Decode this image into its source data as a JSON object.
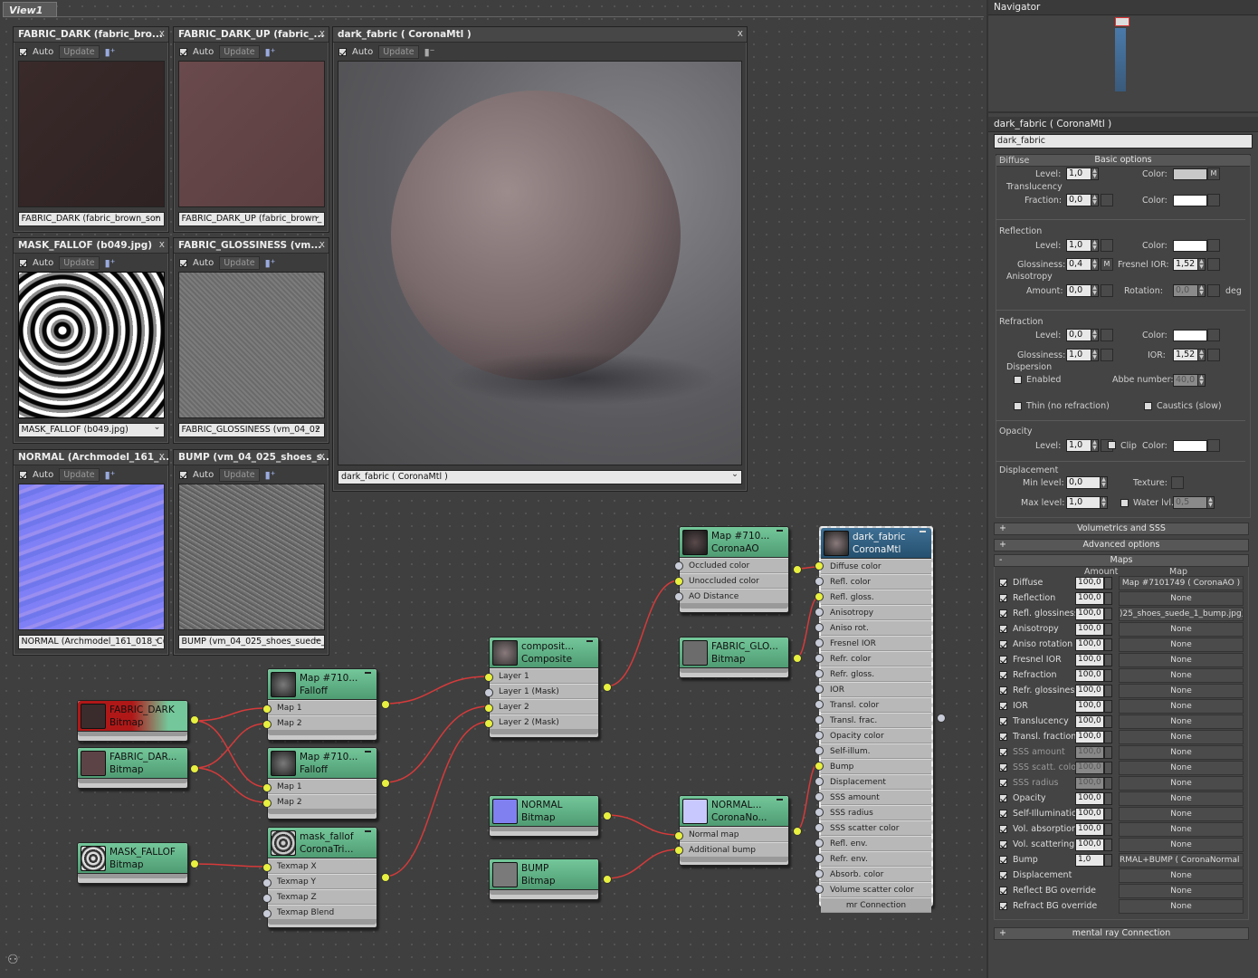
{
  "view": {
    "tab": "View1"
  },
  "previews": {
    "fabric_dark": {
      "title": "FABRIC_DARK (fabric_bro...",
      "dropdown": "FABRIC_DARK (fabric_brown_son"
    },
    "fabric_dark_up": {
      "title": "FABRIC_DARK_UP (fabric_...",
      "dropdown": "FABRIC_DARK_UP (fabric_brown_"
    },
    "dark_fabric": {
      "title": "dark_fabric  ( CoronaMtl )",
      "dropdown": "dark_fabric  ( CoronaMtl )"
    },
    "mask_falloff": {
      "title": "MASK_FALLOF (b049.jpg)",
      "dropdown": "MASK_FALLOF (b049.jpg)"
    },
    "fabric_glossiness": {
      "title": "FABRIC_GLOSSINESS (vm...",
      "dropdown": "FABRIC_GLOSSINESS (vm_04_02"
    },
    "normal": {
      "title": "NORMAL (Archmodel_161_...",
      "dropdown": "NORMAL (Archmodel_161_018_C("
    },
    "bump": {
      "title": "BUMP (vm_04_025_shoes_s...",
      "dropdown": "BUMP (vm_04_025_shoes_suede_"
    },
    "auto_label": "Auto",
    "update_label": "Update",
    "close": "x"
  },
  "nodes": {
    "fabric_dark": {
      "l1": "FABRIC_DARK",
      "l2": "Bitmap"
    },
    "fabric_dar2": {
      "l1": "FABRIC_DAR...",
      "l2": "Bitmap"
    },
    "mask_fallof": {
      "l1": "MASK_FALLOF",
      "l2": "Bitmap"
    },
    "falloff1": {
      "l1": "Map #710...",
      "l2": "Falloff",
      "rows": [
        "Map 1",
        "Map 2"
      ]
    },
    "falloff2": {
      "l1": "Map #710...",
      "l2": "Falloff",
      "rows": [
        "Map 1",
        "Map 2"
      ]
    },
    "triplanar": {
      "l1": "mask_fallof",
      "l2": "CoronaTri...",
      "rows": [
        "Texmap X",
        "Texmap Y",
        "Texmap Z",
        "Texmap Blend"
      ]
    },
    "composite": {
      "l1": "composit...",
      "l2": "Composite",
      "rows": [
        "Layer 1",
        "Layer 1 (Mask)",
        "Layer 2",
        "Layer 2 (Mask)"
      ]
    },
    "normal_bmp": {
      "l1": "NORMAL",
      "l2": "Bitmap"
    },
    "bump_bmp": {
      "l1": "BUMP",
      "l2": "Bitmap"
    },
    "ao": {
      "l1": "Map #710...",
      "l2": "CoronaAO",
      "rows": [
        "Occluded color",
        "Unoccluded color",
        "AO Distance"
      ]
    },
    "gloss_bmp": {
      "l1": "FABRIC_GLO...",
      "l2": "Bitmap"
    },
    "normalmap": {
      "l1": "NORMAL...",
      "l2": "CoronaNo...",
      "rows": [
        "Normal map",
        "Additional bump"
      ]
    },
    "mtl": {
      "l1": "dark_fabric",
      "l2": "CoronaMtl",
      "rows": [
        "Diffuse color",
        "Refl. color",
        "Refl. gloss.",
        "Anisotropy",
        "Aniso rot.",
        "Fresnel IOR",
        "Refr. color",
        "Refr. gloss.",
        "IOR",
        "Transl. color",
        "Transl. frac.",
        "Opacity color",
        "Self-illum.",
        "Bump",
        "Displacement",
        "SSS amount",
        "SSS radius",
        "SSS scatter color",
        "Refl. env.",
        "Refr. env.",
        "Absorb. color",
        "Volume scatter color"
      ],
      "footer": "mr Connection"
    }
  },
  "panel": {
    "navigator": "Navigator",
    "mat_title": "dark_fabric  ( CoronaMtl )",
    "mat_name": "dark_fabric",
    "basic": "Basic options",
    "diffuse": "Diffuse",
    "level": "Level:",
    "color": "Color:",
    "m": "M",
    "translucency": "Translucency",
    "fraction": "Fraction:",
    "reflection": "Reflection",
    "glossiness": "Glossiness:",
    "fresnel": "Fresnel IOR:",
    "anisotropy": "Anisotropy",
    "amount": "Amount:",
    "rotation": "Rotation:",
    "deg": "deg",
    "refraction": "Refraction",
    "ior": "IOR:",
    "dispersion": "Dispersion",
    "enabled": "Enabled",
    "abbe": "Abbe number:",
    "thin": "Thin (no refraction)",
    "caustics": "Caustics (slow)",
    "opacity": "Opacity",
    "clip": "Clip",
    "displacement": "Displacement",
    "minlevel": "Min level:",
    "maxlevel": "Max level:",
    "texture": "Texture:",
    "waterlvl": "Water lvl.",
    "v": {
      "dlevel": "1,0",
      "frac": "0,0",
      "rlevel": "1,0",
      "rgloss": "0,4",
      "rfior": "1,52",
      "aamt": "0,0",
      "arot": "0,0",
      "frlevel": "0,0",
      "frgloss": "1,0",
      "frior": "1,52",
      "abbe": "40,0",
      "olevel": "1,0",
      "dmin": "0,0",
      "dmax": "1,0",
      "water": "0,5"
    },
    "colors": {
      "diffuse": "#c8c8c8",
      "white": "#ffffff"
    },
    "volumetrics": "Volumetrics and SSS",
    "advanced": "Advanced options",
    "maps": "Maps",
    "amount_h": "Amount",
    "map_h": "Map",
    "mental": "mental ray Connection",
    "maprows": [
      {
        "n": "Diffuse",
        "a": "100,0",
        "m": "Map #7101749  ( CoronaAO )",
        "dim": false
      },
      {
        "n": "Reflection",
        "a": "100,0",
        "m": "None",
        "dim": false
      },
      {
        "n": "Refl. glossiness",
        "a": "100,0",
        "m": ")25_shoes_suede_1_bump.jpg)",
        "dim": false
      },
      {
        "n": "Anisotropy",
        "a": "100,0",
        "m": "None",
        "dim": false
      },
      {
        "n": "Aniso rotation",
        "a": "100,0",
        "m": "None",
        "dim": false
      },
      {
        "n": "Fresnel IOR",
        "a": "100,0",
        "m": "None",
        "dim": false
      },
      {
        "n": "Refraction",
        "a": "100,0",
        "m": "None",
        "dim": false
      },
      {
        "n": "Refr. glossiness",
        "a": "100,0",
        "m": "None",
        "dim": false
      },
      {
        "n": "IOR",
        "a": "100,0",
        "m": "None",
        "dim": false
      },
      {
        "n": "Translucency",
        "a": "100,0",
        "m": "None",
        "dim": false
      },
      {
        "n": "Transl. fraction",
        "a": "100,0",
        "m": "None",
        "dim": false
      },
      {
        "n": "SSS amount",
        "a": "100,0",
        "m": "None",
        "dim": true
      },
      {
        "n": "SSS scatt. color",
        "a": "100,0",
        "m": "None",
        "dim": true
      },
      {
        "n": "SSS radius",
        "a": "100,0",
        "m": "None",
        "dim": true
      },
      {
        "n": "Opacity",
        "a": "100,0",
        "m": "None",
        "dim": false
      },
      {
        "n": "Self-Illumination",
        "a": "100,0",
        "m": "None",
        "dim": false
      },
      {
        "n": "Vol. absorption",
        "a": "100,0",
        "m": "None",
        "dim": false
      },
      {
        "n": "Vol. scattering",
        "a": "100,0",
        "m": "None",
        "dim": false
      },
      {
        "n": "Bump",
        "a": "1,0",
        "m": "RMAL+BUMP  ( CoronaNormal )",
        "dim": false
      },
      {
        "n": "Displacement",
        "a": "",
        "m": "None",
        "dim": false
      },
      {
        "n": "Reflect BG override",
        "a": "",
        "m": "None",
        "dim": false
      },
      {
        "n": "Refract BG override",
        "a": "",
        "m": "None",
        "dim": false
      }
    ]
  }
}
